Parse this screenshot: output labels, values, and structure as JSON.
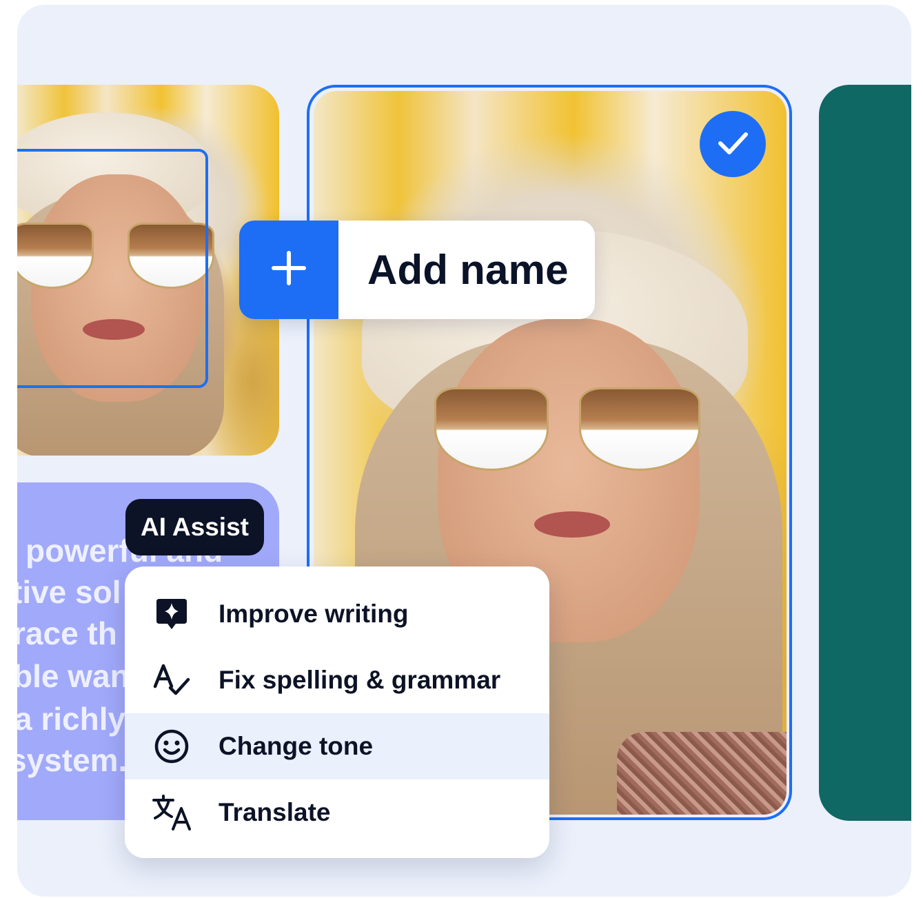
{
  "add_name": {
    "label": "Add name",
    "icon": "plus-icon"
  },
  "selection": {
    "icon": "checkmark-icon",
    "accent": "#1d6ef5"
  },
  "ai_assist": {
    "label": "AI Assist",
    "menu": [
      {
        "label": "Improve writing",
        "icon": "sparkle-speech-bubble-icon"
      },
      {
        "label": "Fix spelling & grammar",
        "icon": "spell-check-icon"
      },
      {
        "label": "Change tone",
        "icon": "smiley-face-icon"
      },
      {
        "label": "Translate",
        "icon": "translate-icon"
      }
    ]
  },
  "text_card": {
    "lines": [
      "powerful and",
      "tive sol",
      "race th",
      "ble wan",
      "a richly",
      "system."
    ]
  },
  "colors": {
    "board": "#ebf0fb",
    "accent_blue": "#1d6ef5",
    "teal_card": "#0f6864",
    "text_card": "#a1a9fa",
    "dark": "#0d1326"
  }
}
